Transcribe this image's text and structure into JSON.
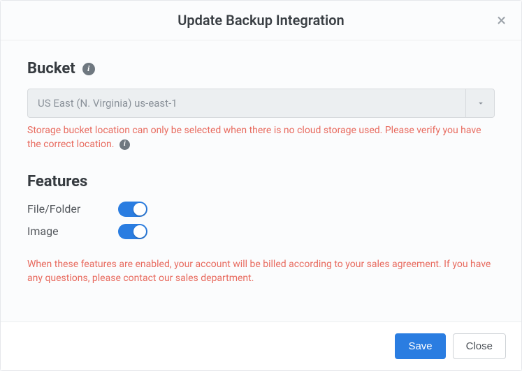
{
  "modal": {
    "title": "Update Backup Integration"
  },
  "bucket": {
    "section_label": "Bucket",
    "selected": "US East (N. Virginia) us-east-1",
    "help": "Storage bucket location can only be selected when there is no cloud storage used. Please verify you have the correct location."
  },
  "features": {
    "section_label": "Features",
    "items": [
      {
        "label": "File/Folder",
        "enabled": true
      },
      {
        "label": "Image",
        "enabled": true
      }
    ],
    "note": "When these features are enabled, your account will be billed according to your sales agreement. If you have any questions, please contact our sales department."
  },
  "footer": {
    "save": "Save",
    "close": "Close"
  }
}
